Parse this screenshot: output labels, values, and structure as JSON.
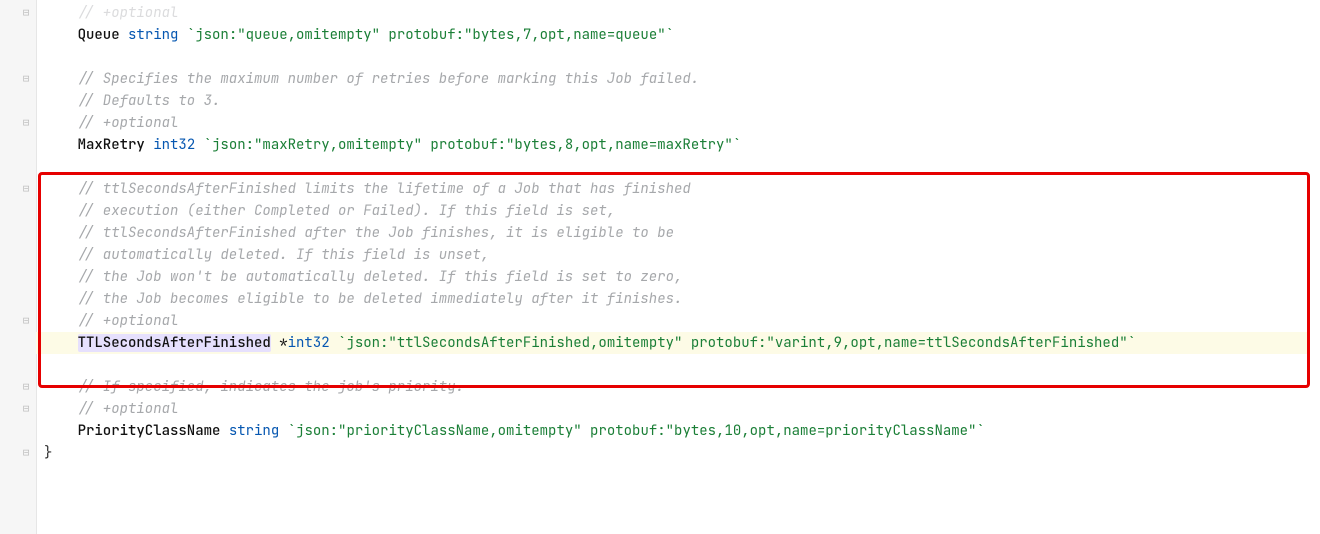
{
  "indent_str": "    ",
  "lines": [
    {
      "kind": "comment",
      "text": "// +optional",
      "dim": true,
      "fold": "close"
    },
    {
      "kind": "field",
      "name": "Queue",
      "type_prefix": "",
      "type": "string",
      "tag": "`json:\"queue,omitempty\" protobuf:\"bytes,7,opt,name=queue\"`"
    },
    {
      "kind": "blank"
    },
    {
      "kind": "comment",
      "text": "// Specifies the maximum number of retries before marking this Job failed.",
      "fold": "open"
    },
    {
      "kind": "comment",
      "text": "// Defaults to 3."
    },
    {
      "kind": "comment",
      "text": "// +optional",
      "fold": "close"
    },
    {
      "kind": "field",
      "name": "MaxRetry",
      "type_prefix": "",
      "type": "int32",
      "tag": "`json:\"maxRetry,omitempty\" protobuf:\"bytes,8,opt,name=maxRetry\"`"
    },
    {
      "kind": "blank"
    },
    {
      "kind": "comment",
      "text": "// ttlSecondsAfterFinished limits the lifetime of a Job that has finished",
      "fold": "open"
    },
    {
      "kind": "comment",
      "text": "// execution (either Completed or Failed). If this field is set,"
    },
    {
      "kind": "comment",
      "text": "// ttlSecondsAfterFinished after the Job finishes, it is eligible to be"
    },
    {
      "kind": "comment",
      "text": "// automatically deleted. If this field is unset,"
    },
    {
      "kind": "comment",
      "text": "// the Job won't be automatically deleted. If this field is set to zero,"
    },
    {
      "kind": "comment",
      "text": "// the Job becomes eligible to be deleted immediately after it finishes."
    },
    {
      "kind": "comment",
      "text": "// +optional",
      "fold": "close"
    },
    {
      "kind": "field",
      "name": "TTLSecondsAfterFinished",
      "type_prefix": "*",
      "type": "int32",
      "tag": "`json:\"ttlSecondsAfterFinished,omitempty\" protobuf:\"varint,9,opt,name=ttlSecondsAfterFinished\"`",
      "highlight": true,
      "select_name": true
    },
    {
      "kind": "blank"
    },
    {
      "kind": "comment",
      "text": "// If specified, indicates the job's priority.",
      "fold": "open"
    },
    {
      "kind": "comment",
      "text": "// +optional",
      "fold": "close"
    },
    {
      "kind": "field",
      "name": "PriorityClassName",
      "type_prefix": "",
      "type": "string",
      "tag": "`json:\"priorityClassName,omitempty\" protobuf:\"bytes,10,opt,name=priorityClassName\"`"
    },
    {
      "kind": "brace",
      "text": "}",
      "fold": "close"
    }
  ],
  "redbox": {
    "top_line_index": 8,
    "bottom_line_index_exclusive": 17
  },
  "fold_glyphs": {
    "open": "⊟",
    "close": "⊟"
  }
}
